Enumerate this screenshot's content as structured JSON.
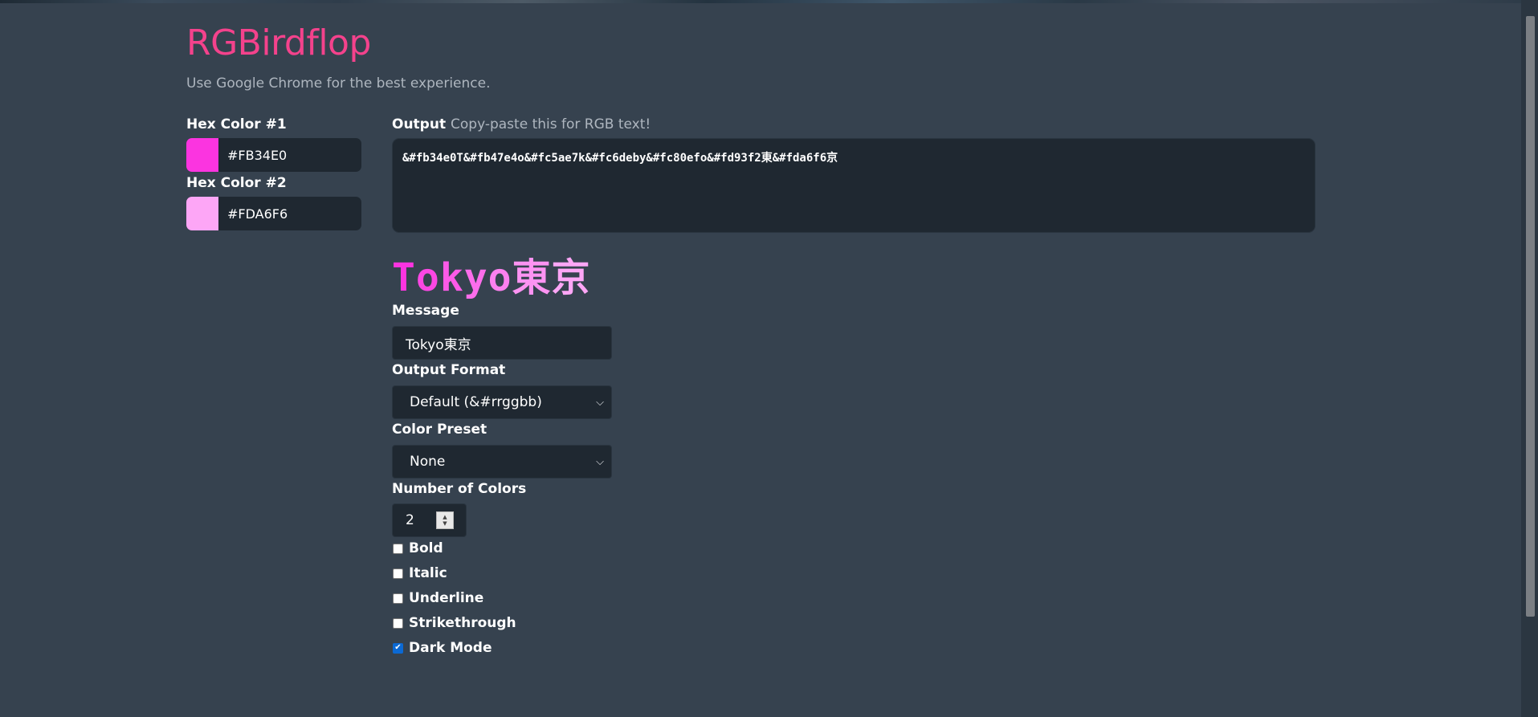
{
  "header": {
    "title": "RGBirdflop",
    "subtitle": "Use Google Chrome for the best experience."
  },
  "colors": [
    {
      "label": "Hex Color #1",
      "value": "#FB34E0",
      "swatch": "#fb34e0"
    },
    {
      "label": "Hex Color #2",
      "value": "#FDA6F6",
      "swatch": "#fda6f6"
    }
  ],
  "output": {
    "label": "Output",
    "hint": "Copy-paste this for RGB text!",
    "text": "&#fb34e0T&#fb47e4o&#fc5ae7k&#fc6deby&#fc80efo&#fd93f2東&#fda6f6京"
  },
  "preview": {
    "chars": [
      {
        "char": "T",
        "color": "#fb34e0"
      },
      {
        "char": "o",
        "color": "#fb47e4"
      },
      {
        "char": "k",
        "color": "#fc5ae7"
      },
      {
        "char": "y",
        "color": "#fc6deb"
      },
      {
        "char": "o",
        "color": "#fc80ef"
      },
      {
        "char": "東",
        "color": "#fd93f2"
      },
      {
        "char": "京",
        "color": "#fda6f6"
      }
    ]
  },
  "message": {
    "label": "Message",
    "value": "Tokyo東京"
  },
  "output_format": {
    "label": "Output Format",
    "selected": "Default (&#rrggbb)"
  },
  "color_preset": {
    "label": "Color Preset",
    "selected": "None"
  },
  "num_colors": {
    "label": "Number of Colors",
    "value": "2"
  },
  "options": [
    {
      "label": "Bold",
      "checked": false
    },
    {
      "label": "Italic",
      "checked": false
    },
    {
      "label": "Underline",
      "checked": false
    },
    {
      "label": "Strikethrough",
      "checked": false
    },
    {
      "label": "Dark Mode",
      "checked": true
    }
  ],
  "icons": {
    "select_chevron": "chevron-down-icon",
    "spinner": "spinner-arrows-icon",
    "check": "checkmark-icon"
  }
}
